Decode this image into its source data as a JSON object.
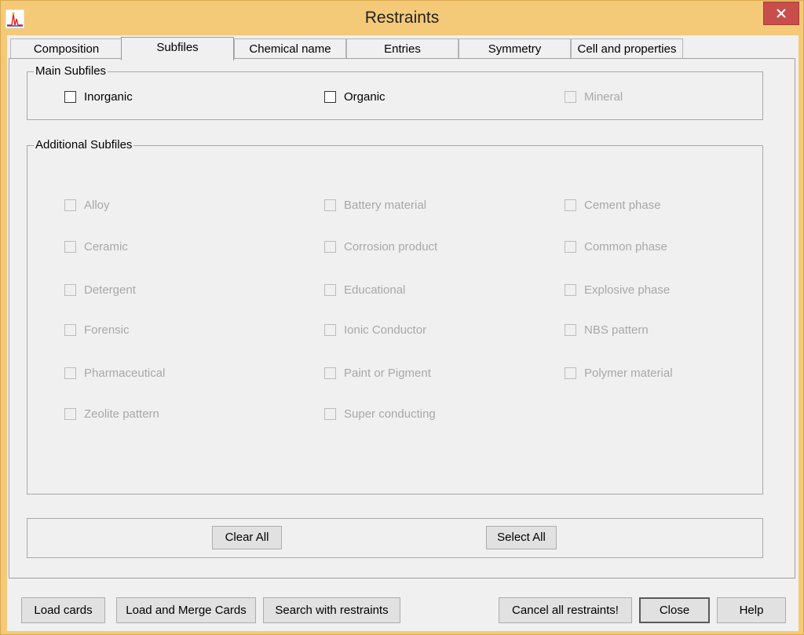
{
  "window": {
    "title": "Restraints"
  },
  "tabs": [
    {
      "label": "Composition"
    },
    {
      "label": "Subfiles"
    },
    {
      "label": "Chemical name"
    },
    {
      "label": "Entries"
    },
    {
      "label": "Symmetry"
    },
    {
      "label": "Cell and properties"
    }
  ],
  "main_subfiles": {
    "title": "Main Subfiles",
    "items": [
      {
        "label": "Inorganic"
      },
      {
        "label": "Organic"
      },
      {
        "label": "Mineral"
      }
    ]
  },
  "additional_subfiles": {
    "title": "Additional Subfiles",
    "items": [
      {
        "label": "Alloy"
      },
      {
        "label": "Battery material"
      },
      {
        "label": "Cement phase"
      },
      {
        "label": "Ceramic"
      },
      {
        "label": "Corrosion product"
      },
      {
        "label": "Common phase"
      },
      {
        "label": "Detergent"
      },
      {
        "label": "Educational"
      },
      {
        "label": "Explosive phase"
      },
      {
        "label": "Forensic"
      },
      {
        "label": "Ionic Conductor"
      },
      {
        "label": "NBS pattern"
      },
      {
        "label": "Pharmaceutical"
      },
      {
        "label": "Paint or Pigment"
      },
      {
        "label": "Polymer material"
      },
      {
        "label": "Zeolite pattern"
      },
      {
        "label": "Super conducting"
      }
    ]
  },
  "panel_buttons": {
    "clear_all": "Clear All",
    "select_all": "Select All"
  },
  "footer": {
    "load_cards": "Load cards",
    "load_merge": "Load and Merge Cards",
    "search": "Search with restraints",
    "cancel_all": "Cancel all restraints!",
    "close": "Close",
    "help": "Help"
  },
  "colors": {
    "titlebar": "#f4ca78",
    "close_button": "#c74e4a",
    "disabled_text": "#a8a8a8"
  }
}
